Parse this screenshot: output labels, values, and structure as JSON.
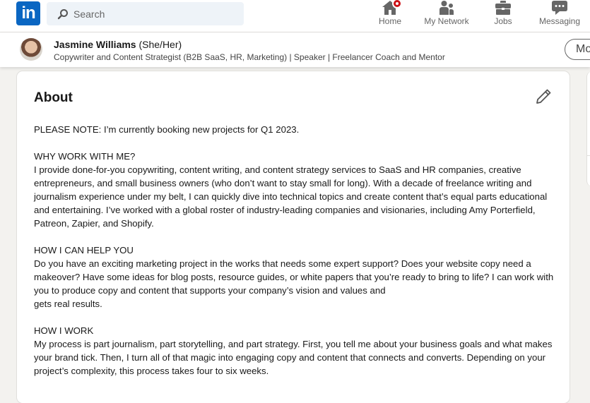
{
  "nav": {
    "logo_text": "in",
    "search_placeholder": "Search",
    "items": [
      {
        "label": "Home",
        "icon": "home-icon",
        "has_badge": true
      },
      {
        "label": "My Network",
        "icon": "network-icon"
      },
      {
        "label": "Jobs",
        "icon": "briefcase-icon"
      },
      {
        "label": "Messaging",
        "icon": "messaging-icon"
      }
    ]
  },
  "profile_bar": {
    "name": "Jasmine Williams",
    "pronouns": "(She/Her)",
    "headline": "Copywriter and Content Strategist (B2B SaaS, HR, Marketing) | Speaker | Freelancer Coach and Mentor",
    "more_button": "More"
  },
  "about": {
    "title": "About",
    "paragraphs": [
      "PLEASE NOTE: I’m currently booking new projects for Q1 2023.",
      "WHY WORK WITH ME?\nI provide done-for-you copywriting, content writing, and content strategy services to SaaS and HR companies, creative entrepreneurs, and small business owners (who don’t want to stay small for long). With a decade of freelance writing and journalism experience under my belt, I can quickly dive into technical topics and create content that’s equal parts educational and entertaining. I’ve worked with a global roster of industry-leading companies and visionaries, including Amy Porterfield, Patreon, Zapier, and Shopify.",
      "HOW I CAN HELP YOU\nDo you have an exciting marketing project in the works that needs some expert support? Does your website copy need a makeover? Have some ideas for blog posts, resource guides, or white papers that you’re ready to bring to life? I can work with you to produce copy and content that supports your company’s vision and values and\ngets real results.",
      "HOW I WORK\nMy process is part journalism, part storytelling, and part strategy. First, you tell me about your business goals and what makes your brand tick. Then, I turn all of that magic into engaging copy and content that connects and converts. Depending on your project’s complexity, this process takes four to six weeks."
    ]
  },
  "colors": {
    "brand": "#0a66c2",
    "badge": "#cc1016",
    "page_bg": "#f3f2ef"
  }
}
